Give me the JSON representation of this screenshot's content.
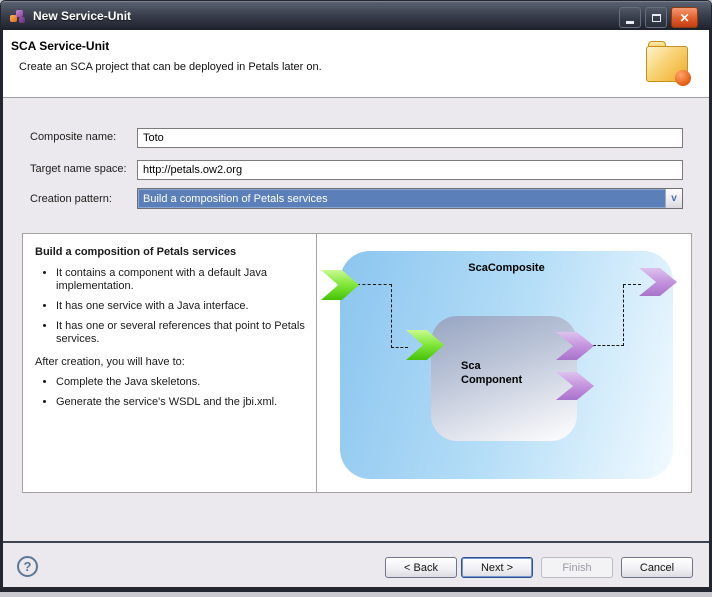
{
  "window": {
    "title": "New Service-Unit",
    "icons": {
      "window_icon": "sca-cubes",
      "minimize": "dash",
      "maximize": "square-outline",
      "close_glyph": "✕"
    }
  },
  "header": {
    "title": "SCA Service-Unit",
    "description": "Create an SCA project that can be deployed in Petals later on.",
    "icon": "new-project-folder"
  },
  "form": {
    "composite_name": {
      "label": "Composite name:",
      "value": "Toto"
    },
    "target_namespace": {
      "label": "Target name space:",
      "value": "http://petals.ow2.org"
    },
    "creation_pattern": {
      "label": "Creation pattern:",
      "value": "Build a composition of Petals services",
      "arrow_glyph": "v"
    }
  },
  "pattern_info": {
    "title": "Build a composition of Petals services",
    "bullets": [
      "It contains a component with a default Java implementation.",
      "It has one service with a Java interface.",
      "It has one or several references that point to Petals services."
    ],
    "after_heading": "After creation, you will have to:",
    "after_bullets": [
      "Complete the Java skeletons.",
      "Generate the service's WSDL and the jbi.xml."
    ]
  },
  "diagram": {
    "composite_label": "ScaComposite",
    "component_label_line1": "Sca",
    "component_label_line2": "Component"
  },
  "footer": {
    "help_glyph": "?",
    "back_label": "< Back",
    "next_label": "Next >",
    "finish_label": "Finish",
    "cancel_label": "Cancel"
  },
  "colors": {
    "titlebar_top": "#5a6170",
    "titlebar_bottom": "#1d212b",
    "close_button": "#e25c2a",
    "selection_blue": "#5b80b9",
    "body_gray": "#ebe9ed",
    "composite_blue": "#8bc5ef",
    "component_slate": "#97a5c2",
    "arrow_green": "#63cf17",
    "arrow_purple": "#b583d3",
    "folder_orange": "#f0a92e"
  }
}
